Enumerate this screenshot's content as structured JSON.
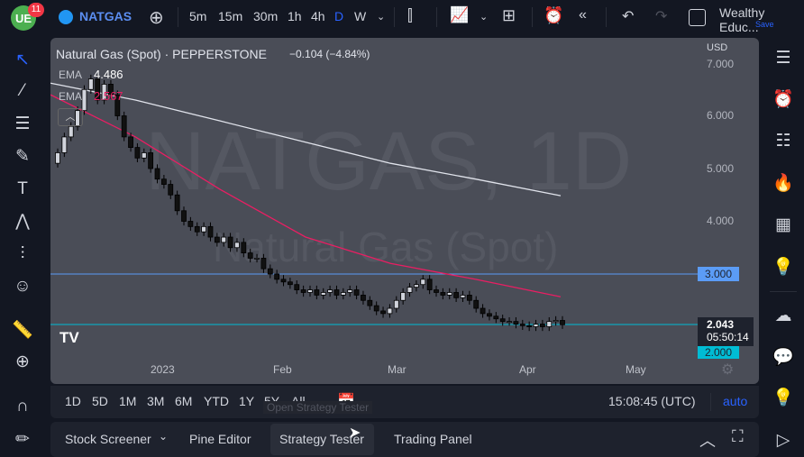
{
  "topbar": {
    "notifications": "11",
    "symbol": "NATGAS",
    "intervals": [
      "5m",
      "15m",
      "30m",
      "1h",
      "4h",
      "D",
      "W"
    ],
    "active_interval": "D",
    "layout_name": "Wealthy Educ...",
    "save_label": "Save"
  },
  "legend": {
    "title": "Natural Gas (Spot) · PEPPERSTONE",
    "change": "−0.104 (−4.84%)",
    "ema1_label": "EMA",
    "ema1_value": "4.486",
    "ema2_label": "EMA",
    "ema2_value": "2.567"
  },
  "watermark": {
    "ticker": "NATGAS, 1D",
    "name": "Natural Gas (Spot)"
  },
  "axis": {
    "currency": "USD",
    "price_labels": [
      "7.000",
      "6.000",
      "5.000",
      "4.000"
    ],
    "time_labels": [
      "2023",
      "Feb",
      "Mar",
      "Apr",
      "May"
    ],
    "hline_label": "3.000",
    "last_price": "2.043",
    "countdown": "05:50:14",
    "support_label": "2.000"
  },
  "range": {
    "buttons": [
      "1D",
      "5D",
      "1M",
      "3M",
      "6M",
      "YTD",
      "1Y",
      "5Y",
      "All"
    ],
    "time": "15:08:45 (UTC)",
    "auto": "auto",
    "tooltip": "Open Strategy Tester"
  },
  "bottom": {
    "tabs": [
      "Stock Screener",
      "Pine Editor",
      "Strategy Tester",
      "Trading Panel"
    ]
  },
  "colors": {
    "accent": "#2962ff",
    "ema_long": "#e0e3eb",
    "ema_short": "#e91e63",
    "hline": "#5b9cf6",
    "support": "#00bcd4"
  },
  "chart_data": {
    "type": "candlestick",
    "ylim": [
      1.0,
      7.5
    ],
    "closes": [
      5.3,
      5.6,
      5.8,
      6.1,
      6.5,
      6.7,
      6.3,
      6.6,
      6.4,
      6.0,
      5.6,
      5.4,
      5.2,
      5.3,
      5.0,
      4.8,
      4.7,
      4.5,
      4.2,
      4.0,
      3.9,
      3.8,
      3.9,
      3.7,
      3.6,
      3.7,
      3.5,
      3.6,
      3.4,
      3.3,
      3.3,
      3.1,
      3.0,
      2.9,
      2.85,
      2.8,
      2.7,
      2.65,
      2.7,
      2.6,
      2.65,
      2.7,
      2.6,
      2.65,
      2.7,
      2.6,
      2.5,
      2.4,
      2.3,
      2.25,
      2.35,
      2.5,
      2.65,
      2.75,
      2.8,
      2.9,
      2.7,
      2.65,
      2.6,
      2.65,
      2.55,
      2.6,
      2.5,
      2.35,
      2.25,
      2.2,
      2.15,
      2.1,
      2.1,
      2.05,
      2.02,
      2.0,
      2.05,
      2.0,
      2.1,
      2.12,
      2.04
    ],
    "ema_long": [
      6.62,
      6.3,
      5.9,
      5.5,
      5.1,
      4.8,
      4.486
    ],
    "ema_short": [
      6.4,
      5.6,
      4.6,
      3.7,
      3.2,
      2.9,
      2.567
    ]
  }
}
